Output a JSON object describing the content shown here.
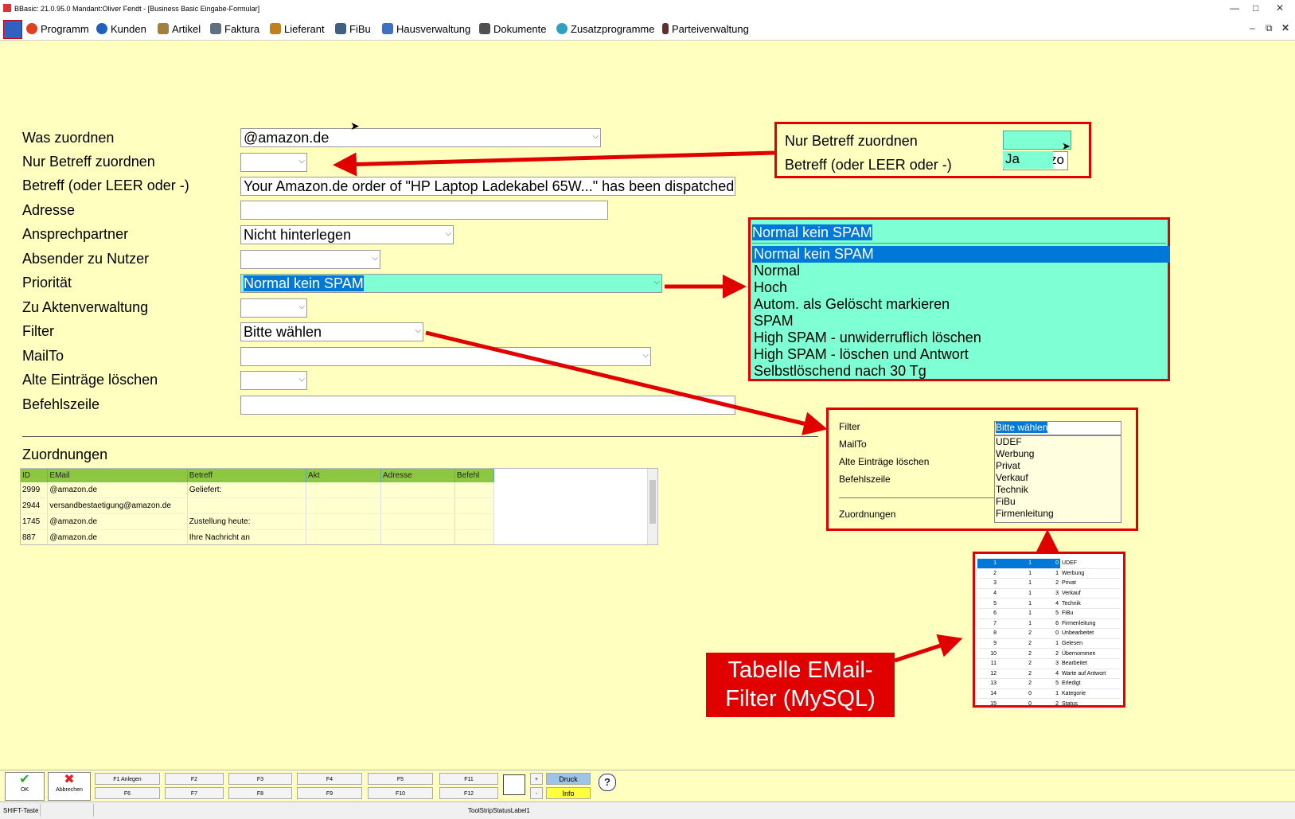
{
  "window": {
    "title": "BBasic: 21.0.95.0 Mandant:Oliver Fendt - [Business Basic Eingabe-Formular]"
  },
  "menu": [
    {
      "label": "Programm",
      "icon": "globe-icon",
      "color": "#e04020"
    },
    {
      "label": "Kunden",
      "icon": "user-icon",
      "color": "#2060c0"
    },
    {
      "label": "Artikel",
      "icon": "box-icon",
      "color": "#a08040"
    },
    {
      "label": "Faktura",
      "icon": "factory-icon",
      "color": "#607080"
    },
    {
      "label": "Lieferant",
      "icon": "truck-icon",
      "color": "#c08020"
    },
    {
      "label": "FiBu",
      "icon": "ledger-icon",
      "color": "#406080"
    },
    {
      "label": "Hausverwaltung",
      "icon": "house-icon",
      "color": "#4070c0"
    },
    {
      "label": "Dokumente",
      "icon": "document-icon",
      "color": "#505050"
    },
    {
      "label": "Zusatzprogramme",
      "icon": "puzzle-icon",
      "color": "#30a0c0"
    },
    {
      "label": "Parteiverwaltung",
      "icon": "person-icon",
      "color": "#603030"
    }
  ],
  "form": {
    "labels": {
      "was": "Was zuordnen",
      "nur_betreff": "Nur Betreff zuordnen",
      "betreff": "Betreff (oder LEER oder -)",
      "adresse": "Adresse",
      "ansprechpartner": "Ansprechpartner",
      "absender": "Absender zu Nutzer",
      "prioritaet": "Priorität",
      "akten": "Zu Aktenverwaltung",
      "filter": "Filter",
      "mailto": "MailTo",
      "alte": "Alte Einträge löschen",
      "befehl": "Befehlszeile"
    },
    "values": {
      "was": "@amazon.de",
      "nur_betreff": "",
      "betreff": "Your Amazon.de order of \"HP Laptop Ladekabel 65W...\" has been dispatched!",
      "adresse": "",
      "ansprechpartner": "Nicht hinterlegen",
      "absender": "",
      "prioritaet": "Normal kein SPAM",
      "akten": "",
      "filter": "Bitte wählen",
      "mailto": "",
      "alte": "",
      "befehl": ""
    }
  },
  "zuordnungen": {
    "title": "Zuordnungen",
    "columns": [
      "ID",
      "EMail",
      "Betreff",
      "Akt",
      "Adresse",
      "Befehl"
    ],
    "rows": [
      [
        "2999",
        "@amazon.de",
        "Geliefert:",
        "",
        "",
        ""
      ],
      [
        "2944",
        "versandbestaetigung@amazon.de",
        "",
        "",
        "",
        ""
      ],
      [
        "1745",
        "@amazon.de",
        "Zustellung heute:",
        "",
        "",
        ""
      ],
      [
        "887",
        "@amazon.de",
        "Ihre Nachricht an",
        "",
        "",
        ""
      ]
    ]
  },
  "callout_betreff": {
    "label1": "Nur Betreff zuordnen",
    "label2": "Betreff (oder LEER oder -)",
    "option": "Ja",
    "partial": "zo"
  },
  "callout_prio": {
    "selected": "Normal kein SPAM",
    "options": [
      "Normal kein SPAM",
      "Normal",
      "Hoch",
      "Autom. als Gelöscht markieren",
      "SPAM",
      "High SPAM - unwiderruflich löschen",
      "High SPAM - löschen und Antwort",
      "Selbstlöschend nach 30 Tg"
    ]
  },
  "callout_filter": {
    "labels": [
      "Filter",
      "MailTo",
      "Alte Einträge löschen",
      "Befehlszeile",
      "Zuordnungen"
    ],
    "selected": "Bitte wählen",
    "options": [
      "UDEF",
      "Werbung",
      "Privat",
      "Verkauf",
      "Technik",
      "FiBu",
      "Firmenleitung"
    ]
  },
  "mini_table": {
    "rows": [
      [
        "1",
        "1",
        "0",
        "UDEF"
      ],
      [
        "2",
        "1",
        "1",
        "Werbung"
      ],
      [
        "3",
        "1",
        "2",
        "Privat"
      ],
      [
        "4",
        "1",
        "3",
        "Verkauf"
      ],
      [
        "5",
        "1",
        "4",
        "Technik"
      ],
      [
        "6",
        "1",
        "5",
        "FiBu"
      ],
      [
        "7",
        "1",
        "6",
        "Firmenleitung"
      ],
      [
        "8",
        "2",
        "0",
        "Unbearbeitet"
      ],
      [
        "9",
        "2",
        "1",
        "Gelesen"
      ],
      [
        "10",
        "2",
        "2",
        "Übernommen"
      ],
      [
        "11",
        "2",
        "3",
        "Bearbeitet"
      ],
      [
        "12",
        "2",
        "4",
        "Warte auf Antwort"
      ],
      [
        "13",
        "2",
        "5",
        "Erledigt"
      ],
      [
        "14",
        "0",
        "1",
        "Kategorie"
      ],
      [
        "15",
        "0",
        "2",
        "Status"
      ]
    ]
  },
  "annotation": {
    "text": "Tabelle EMail-Filter (MySQL)",
    "color": "#e00000"
  },
  "bottom": {
    "ok": "OK",
    "abbrechen": "Abbrechen",
    "fkeys_top": [
      "F1 Anlegen",
      "F2",
      "F3",
      "F4",
      "F5",
      "F11"
    ],
    "fkeys_bottom": [
      "F6",
      "F7",
      "F8",
      "F9",
      "F10",
      "F12"
    ],
    "plus": "+",
    "minus": "-",
    "druck": "Druck",
    "info": "Info",
    "status_left": "SHIFT-Taste",
    "status_center": "ToolStripStatusLabel1"
  }
}
